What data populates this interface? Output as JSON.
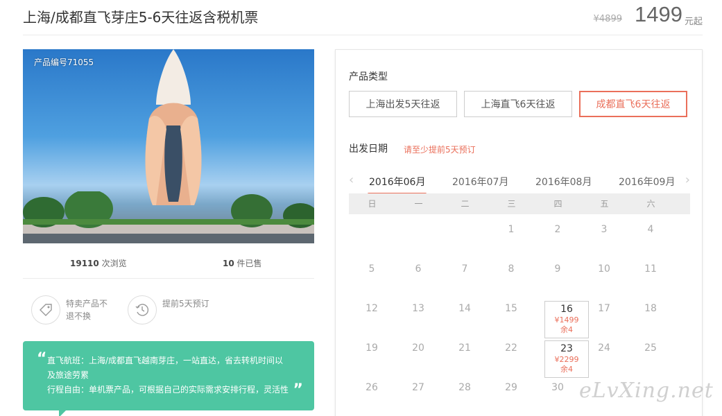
{
  "header": {
    "title": "上海/成都直飞芽庄5-6天往返含税机票",
    "old_price": "¥4899",
    "price": "1499",
    "price_unit": "元起"
  },
  "product": {
    "id_label": "产品编号71055",
    "views_num": "19110",
    "views_label": "次浏览",
    "sold_num": "10",
    "sold_label": "件已售",
    "features": [
      {
        "icon": "tag-icon",
        "text": "特卖产品不退不换"
      },
      {
        "icon": "clock-history-icon",
        "text": "提前5天预订"
      }
    ],
    "quote_lines": [
      "直飞航班：上海/成都直飞越南芽庄，一站直达，省去转机时间以",
      "及旅途劳累",
      "行程自由：单机票产品，可根据自己的实际需求安排行程，灵活性"
    ]
  },
  "booking": {
    "type_title": "产品类型",
    "types": [
      "上海出发5天往返",
      "上海直飞6天往返",
      "成都直飞6天往返"
    ],
    "active_type": 2,
    "date_title": "出发日期",
    "date_hint": "请至少提前5天预订",
    "months": [
      "2016年06月",
      "2016年07月",
      "2016年08月",
      "2016年09月"
    ],
    "active_month": 0,
    "weekdays": [
      "日",
      "一",
      "二",
      "三",
      "四",
      "五",
      "六"
    ],
    "first_weekday": 3,
    "days_shown": 30,
    "available": {
      "16": {
        "price": "¥1499",
        "remain": "余4"
      },
      "23": {
        "price": "¥2299",
        "remain": "余4"
      }
    }
  },
  "watermark": "eLvXing.net",
  "colors": {
    "accent": "#ea6f5a",
    "quote_bg": "#4ec6a2"
  }
}
